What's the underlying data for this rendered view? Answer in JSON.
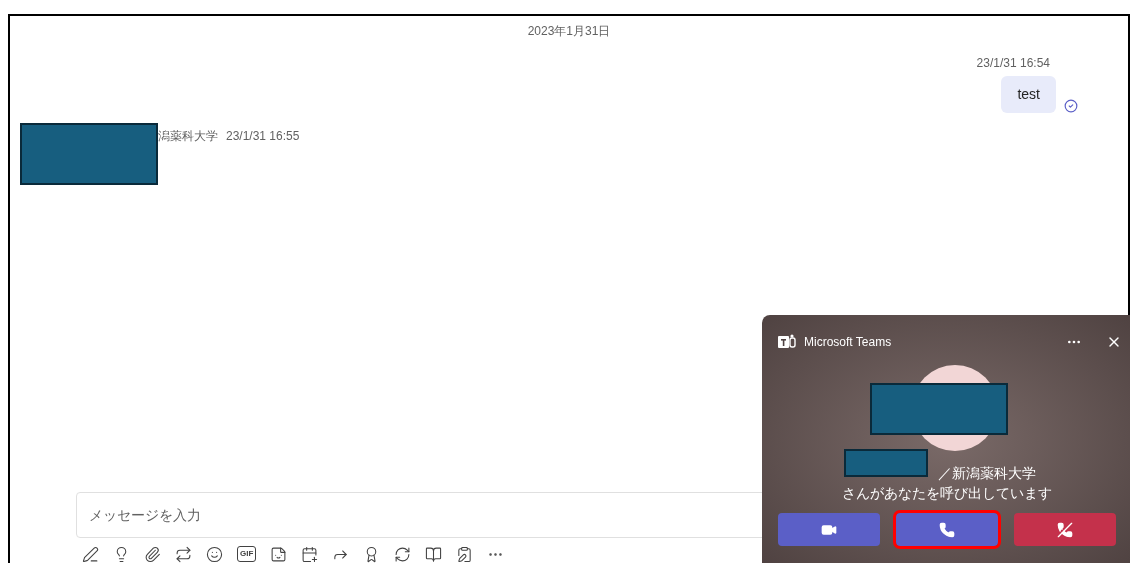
{
  "chat": {
    "date_divider": "2023年1月31日",
    "sent_message": {
      "timestamp": "23/1/31 16:54",
      "text": "test",
      "read": true
    },
    "received_message": {
      "sender": "潟薬科大学",
      "timestamp": "23/1/31 16:55"
    }
  },
  "composer": {
    "placeholder": "メッセージを入力",
    "toolbar": [
      {
        "kind": "format"
      },
      {
        "kind": "priority"
      },
      {
        "kind": "attach"
      },
      {
        "kind": "loop"
      },
      {
        "kind": "emoji"
      },
      {
        "kind": "gif",
        "label": "GIF"
      },
      {
        "kind": "sticker"
      },
      {
        "kind": "schedule"
      },
      {
        "kind": "stream"
      },
      {
        "kind": "praise"
      },
      {
        "kind": "approval"
      },
      {
        "kind": "notes"
      },
      {
        "kind": "forms"
      },
      {
        "kind": "more"
      }
    ]
  },
  "call_popup": {
    "app_name": "Microsoft Teams",
    "caller_org": "／新潟薬科大学",
    "calling_text": "さんがあなたを呼び出しています",
    "buttons": [
      {
        "kind": "video",
        "selected": false
      },
      {
        "kind": "audio",
        "selected": true
      },
      {
        "kind": "decline",
        "selected": false
      }
    ]
  }
}
